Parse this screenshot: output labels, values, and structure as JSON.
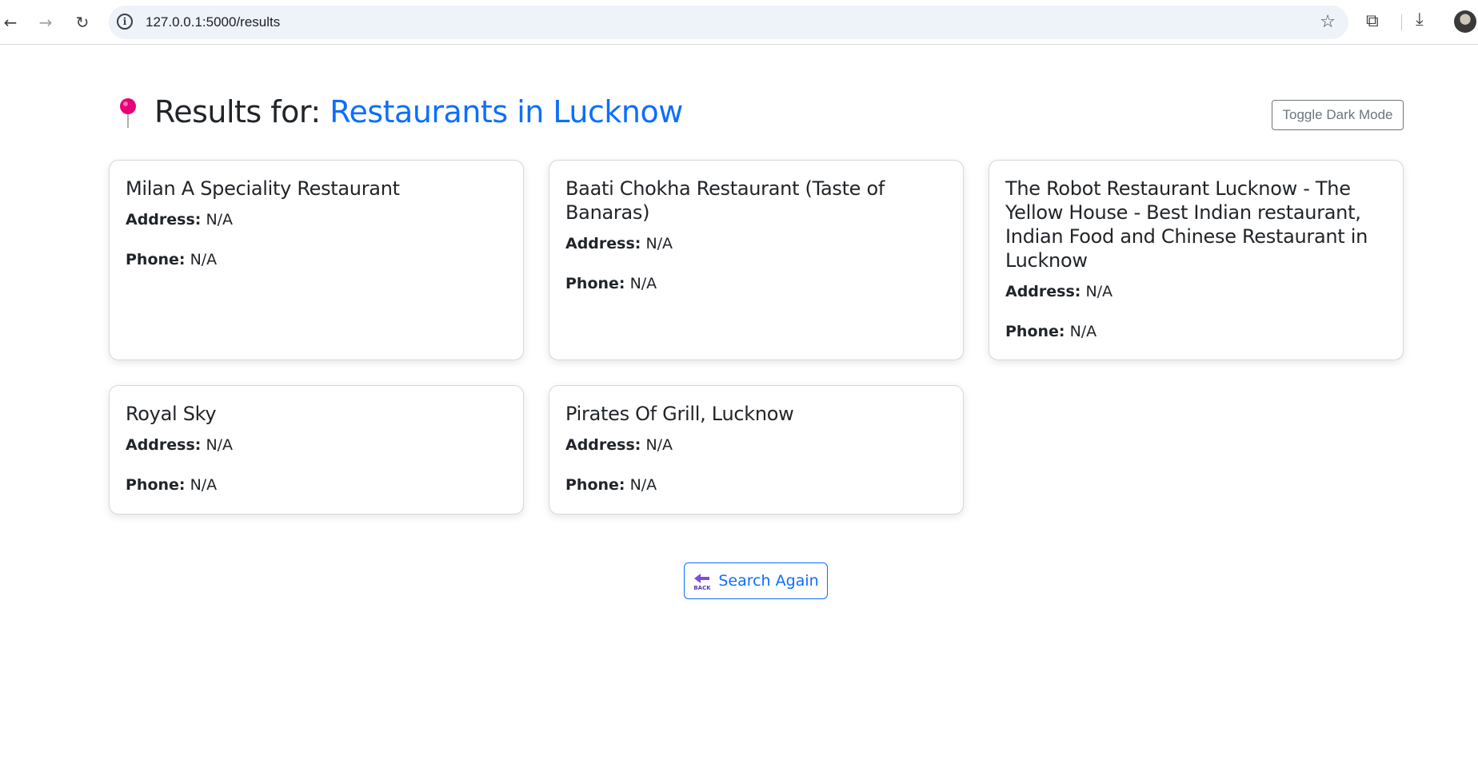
{
  "browser": {
    "url": "127.0.0.1:5000/results",
    "icons": [
      "back-arrow-icon",
      "forward-arrow-icon",
      "reload-icon",
      "info-icon",
      "star-icon",
      "extensions-icon",
      "download-icon",
      "profile-avatar"
    ]
  },
  "header": {
    "title_prefix": "Results for:",
    "query": "Restaurants in Lucknow",
    "pin_icon": "pushpin-icon",
    "toggle_label": "Toggle Dark Mode"
  },
  "labels": {
    "address": "Address:",
    "phone": "Phone:"
  },
  "results": [
    {
      "name": "Milan A Speciality Restaurant",
      "address": "N/A",
      "phone": "N/A"
    },
    {
      "name": "Baati Chokha Restaurant (Taste of Banaras)",
      "address": "N/A",
      "phone": "N/A"
    },
    {
      "name": "The Robot Restaurant Lucknow - The Yellow House - Best Indian restaurant, Indian Food and Chinese Restaurant in Lucknow",
      "address": "N/A",
      "phone": "N/A"
    },
    {
      "name": "Royal Sky",
      "address": "N/A",
      "phone": "N/A"
    },
    {
      "name": "Pirates Of Grill, Lucknow",
      "address": "N/A",
      "phone": "N/A"
    }
  ],
  "footer": {
    "search_again_label": "Search Again",
    "back_icon": "back-icon"
  },
  "colors": {
    "accent": "#0d6efd",
    "pin": "#e6007a",
    "secondary": "#6c757d"
  }
}
